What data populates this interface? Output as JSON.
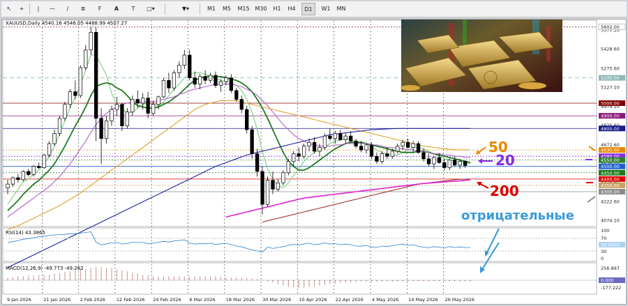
{
  "toolbar": {
    "timeframes": [
      "M1",
      "M5",
      "M15",
      "M30",
      "H1",
      "H4",
      "D1",
      "W1",
      "MN"
    ],
    "icons": [
      "cursor-icon",
      "crosshair-icon",
      "vertical-line-icon",
      "horizontal-line-icon",
      "trendline-icon",
      "channel-icon",
      "fibonacci-icon",
      "text-icon",
      "label-icon",
      "shapes-icon"
    ]
  },
  "chart": {
    "symbol_line": "XAUUSD,Daily  4540.16 4546.05 4488.99 4507.27",
    "rsi_label": "RSI(14) 43.3865",
    "macd_label": "MACD(12,26,9) -49.773 -49.262",
    "bg_color": "#ffffff",
    "bull_color": "#ffffff",
    "bear_color": "#000000"
  },
  "price_axis": {
    "ticks": [
      "5577.10",
      "5428.60",
      "5275.60",
      "5127.10",
      "4974.10",
      "4825.60",
      "4672.60",
      "4524.10",
      "4375.60",
      "4222.60",
      "4074.10"
    ],
    "labels": [
      {
        "text": "5602.00",
        "bg": "#ffffff",
        "fg": "#222222",
        "border": "#888888",
        "price": 5602
      },
      {
        "text": "5200.00",
        "bg": "#8fb8b8",
        "fg": "#ffffff",
        "price": 5200
      },
      {
        "text": "5000.00",
        "bg": "#800000",
        "fg": "#ffffff",
        "price": 5000
      },
      {
        "text": "4900.00",
        "bg": "#8a1a7a",
        "fg": "#ffffff",
        "price": 4900
      },
      {
        "text": "4800.00",
        "bg": "#1a1a8a",
        "fg": "#ffffff",
        "price": 4800
      },
      {
        "text": "4630.00",
        "bg": "#e88a00",
        "fg": "#ffffff",
        "price": 4630
      },
      {
        "text": "4580.00",
        "bg": "#8a2be2",
        "fg": "#ffffff",
        "price": 4580
      },
      {
        "text": "4550.00",
        "bg": "#2e7d32",
        "fg": "#ffffff",
        "price": 4550
      },
      {
        "text": "4500.00",
        "bg": "#1e60d0",
        "fg": "#ffffff",
        "price": 4500
      },
      {
        "text": "4450.00",
        "bg": "#1a7a1a",
        "fg": "#ffffff",
        "price": 4450
      },
      {
        "text": "4400.00",
        "bg": "#e00000",
        "fg": "#ffffff",
        "price": 4400
      },
      {
        "text": "4350.00",
        "bg": "#c8a060",
        "fg": "#ffffff",
        "price": 4350
      },
      {
        "text": "4300.00",
        "bg": "#8a8a8a",
        "fg": "#ffffff",
        "price": 4300
      }
    ]
  },
  "rsi_axis": {
    "ticks": [
      "100",
      "70",
      "30",
      "0"
    ],
    "current": "50.0000"
  },
  "macd_axis": {
    "ticks": [
      "256.897",
      "0.000",
      "-177.222"
    ]
  },
  "time_axis": [
    "9 Jan 2026",
    "21 Jan 2026",
    "2 Feb 2026",
    "12 Feb 2026",
    "24 Feb 2026",
    "6 Mar 2026",
    "18 Mar 2026",
    "30 Mar 2026",
    "10 Apr 2026",
    "22 Apr 2026",
    "4 May 2026",
    "14 May 2026",
    "26 May 2026"
  ],
  "annotations": {
    "ma50": {
      "text": "50",
      "color": "#e88a00"
    },
    "ma20": {
      "text": "20",
      "color": "#8a2be2"
    },
    "ma200": {
      "text": "200",
      "color": "#e00000"
    },
    "negative": {
      "text": "отрицательные",
      "color": "#3a9ad9"
    }
  },
  "candles": [
    [
      4330,
      4395,
      4280,
      4360
    ],
    [
      4360,
      4420,
      4340,
      4410
    ],
    [
      4410,
      4440,
      4370,
      4395
    ],
    [
      4395,
      4470,
      4380,
      4460
    ],
    [
      4460,
      4480,
      4420,
      4435
    ],
    [
      4435,
      4510,
      4420,
      4500
    ],
    [
      4500,
      4530,
      4480,
      4490
    ],
    [
      4490,
      4600,
      4480,
      4590
    ],
    [
      4590,
      4700,
      4570,
      4680
    ],
    [
      4680,
      4790,
      4660,
      4760
    ],
    [
      4760,
      4900,
      4740,
      4880
    ],
    [
      4880,
      5010,
      4860,
      4990
    ],
    [
      4990,
      5110,
      4960,
      5090
    ],
    [
      5090,
      5180,
      5030,
      5060
    ],
    [
      5060,
      5300,
      5040,
      5280
    ],
    [
      5280,
      5460,
      5260,
      5420
    ],
    [
      5420,
      5602,
      5380,
      5560
    ],
    [
      5560,
      5600,
      4700,
      4880
    ],
    [
      4880,
      4960,
      4520,
      4720
    ],
    [
      4720,
      4900,
      4680,
      4860
    ],
    [
      4860,
      4980,
      4820,
      4950
    ],
    [
      4950,
      5050,
      4900,
      4990
    ],
    [
      4990,
      5000,
      4780,
      4820
    ],
    [
      4820,
      4960,
      4800,
      4930
    ],
    [
      4930,
      5060,
      4900,
      5030
    ],
    [
      5030,
      5100,
      4960,
      5000
    ],
    [
      5000,
      5080,
      4950,
      5040
    ],
    [
      5040,
      5090,
      4880,
      4920
    ],
    [
      4920,
      5020,
      4900,
      4990
    ],
    [
      4990,
      5060,
      4950,
      5050
    ],
    [
      5050,
      5200,
      5040,
      5180
    ],
    [
      5180,
      5240,
      5080,
      5120
    ],
    [
      5120,
      5260,
      5100,
      5240
    ],
    [
      5240,
      5330,
      5200,
      5300
    ],
    [
      5300,
      5420,
      5270,
      5380
    ],
    [
      5380,
      5420,
      5180,
      5200
    ],
    [
      5200,
      5250,
      5120,
      5150
    ],
    [
      5150,
      5230,
      5110,
      5210
    ],
    [
      5210,
      5260,
      5150,
      5180
    ],
    [
      5180,
      5240,
      5160,
      5220
    ],
    [
      5220,
      5250,
      5120,
      5140
    ],
    [
      5140,
      5190,
      5090,
      5170
    ],
    [
      5170,
      5220,
      5140,
      5200
    ],
    [
      5200,
      5230,
      5080,
      5100
    ],
    [
      5100,
      5120,
      5010,
      5030
    ],
    [
      5030,
      5060,
      4920,
      4950
    ],
    [
      4950,
      4980,
      4760,
      4790
    ],
    [
      4790,
      4820,
      4560,
      4600
    ],
    [
      4600,
      4640,
      4420,
      4460
    ],
    [
      4460,
      4500,
      4120,
      4200
    ],
    [
      4200,
      4420,
      4180,
      4390
    ],
    [
      4390,
      4460,
      4280,
      4320
    ],
    [
      4320,
      4400,
      4300,
      4370
    ],
    [
      4370,
      4470,
      4350,
      4450
    ],
    [
      4450,
      4560,
      4430,
      4540
    ],
    [
      4540,
      4620,
      4500,
      4600
    ],
    [
      4600,
      4650,
      4540,
      4580
    ],
    [
      4580,
      4680,
      4560,
      4660
    ],
    [
      4660,
      4720,
      4620,
      4690
    ],
    [
      4690,
      4730,
      4600,
      4620
    ],
    [
      4620,
      4680,
      4580,
      4650
    ],
    [
      4650,
      4760,
      4630,
      4740
    ],
    [
      4740,
      4800,
      4700,
      4720
    ],
    [
      4720,
      4780,
      4680,
      4760
    ],
    [
      4760,
      4790,
      4700,
      4710
    ],
    [
      4710,
      4760,
      4680,
      4740
    ],
    [
      4740,
      4780,
      4690,
      4700
    ],
    [
      4700,
      4720,
      4640,
      4660
    ],
    [
      4660,
      4700,
      4610,
      4630
    ],
    [
      4630,
      4680,
      4600,
      4670
    ],
    [
      4670,
      4690,
      4560,
      4580
    ],
    [
      4580,
      4610,
      4520,
      4540
    ],
    [
      4540,
      4620,
      4520,
      4600
    ],
    [
      4600,
      4650,
      4560,
      4580
    ],
    [
      4580,
      4640,
      4560,
      4620
    ],
    [
      4620,
      4680,
      4600,
      4660
    ],
    [
      4660,
      4710,
      4630,
      4690
    ],
    [
      4690,
      4720,
      4640,
      4650
    ],
    [
      4650,
      4700,
      4610,
      4680
    ],
    [
      4680,
      4700,
      4600,
      4610
    ],
    [
      4610,
      4640,
      4540,
      4560
    ],
    [
      4560,
      4600,
      4500,
      4520
    ],
    [
      4520,
      4580,
      4480,
      4570
    ],
    [
      4570,
      4600,
      4520,
      4530
    ],
    [
      4530,
      4560,
      4470,
      4490
    ],
    [
      4490,
      4560,
      4470,
      4550
    ],
    [
      4550,
      4580,
      4500,
      4510
    ],
    [
      4510,
      4560,
      4480,
      4540
    ],
    [
      4540,
      4546,
      4489,
      4507
    ]
  ],
  "ma_lines": [
    {
      "name": "ma5",
      "color": "#7ccf7c",
      "values": [
        4200,
        4260,
        4320,
        4380,
        4400,
        4440,
        4470,
        4520,
        4580,
        4660,
        4760,
        4860,
        4960,
        5050,
        5140,
        5260,
        5380,
        5380,
        5300,
        5220,
        5080,
        4980,
        4960,
        4920,
        4930,
        4960,
        4990,
        5000,
        4990,
        4980,
        5010,
        5060,
        5110,
        5150,
        5200,
        5230,
        5240,
        5240,
        5230,
        5210,
        5190,
        5180,
        5170,
        5160,
        5140,
        5100,
        5030,
        4930,
        4790,
        4620,
        4480,
        4400,
        4350,
        4330,
        4370,
        4430,
        4480,
        4540,
        4580,
        4610,
        4630,
        4650,
        4680,
        4700,
        4710,
        4720,
        4710,
        4700,
        4690,
        4680,
        4660,
        4630,
        4610,
        4600,
        4590,
        4590,
        4610,
        4630,
        4650,
        4650,
        4640,
        4620,
        4600,
        4580,
        4560,
        4550,
        4540,
        4530,
        4530,
        4520
      ]
    },
    {
      "name": "ma10",
      "color": "#1e7a1e",
      "values": [
        4150,
        4190,
        4230,
        4280,
        4320,
        4360,
        4390,
        4430,
        4470,
        4520,
        4590,
        4660,
        4740,
        4820,
        4890,
        4970,
        5060,
        5130,
        5150,
        5160,
        5150,
        5120,
        5100,
        5060,
        5010,
        4980,
        4970,
        4960,
        4960,
        4970,
        4990,
        5010,
        5040,
        5070,
        5110,
        5150,
        5180,
        5200,
        5210,
        5210,
        5210,
        5210,
        5200,
        5190,
        5180,
        5160,
        5130,
        5090,
        5030,
        4960,
        4880,
        4790,
        4700,
        4610,
        4540,
        4500,
        4470,
        4470,
        4490,
        4520,
        4550,
        4580,
        4610,
        4640,
        4660,
        4680,
        4690,
        4690,
        4690,
        4680,
        4670,
        4660,
        4650,
        4640,
        4630,
        4620,
        4610,
        4610,
        4610,
        4620,
        4620,
        4610,
        4600,
        4590,
        4580,
        4570,
        4560,
        4550,
        4540,
        4530
      ]
    },
    {
      "name": "ma20",
      "color": "#b060d0",
      "values": [
        4100,
        4130,
        4160,
        4190,
        4220,
        4250,
        4280,
        4310,
        4340,
        4380,
        4420,
        4470,
        4520,
        4580,
        4640,
        4700,
        4770,
        4830,
        4880,
        4920,
        4950,
        4970,
        4990,
        5000,
        5010,
        5010,
        5010,
        5010,
        5010,
        5020,
        5030,
        5040,
        5050,
        5070,
        5080,
        5100,
        5110,
        5120,
        5130,
        5140,
        5150,
        5150,
        5150,
        5150,
        5140,
        5130,
        5110,
        5090,
        5060,
        5020,
        4980,
        4930,
        4880,
        4830,
        4790,
        4750,
        4720,
        4700,
        4680,
        4670,
        4660,
        4660,
        4660,
        4670,
        4670,
        4680,
        4680,
        4680,
        4680,
        4680,
        4670,
        4670,
        4660,
        4650,
        4650,
        4640,
        4640,
        4630,
        4630,
        4620,
        4620,
        4610,
        4600,
        4600,
        4590,
        4590,
        4580,
        4580,
        4570,
        4570
      ]
    },
    {
      "name": "ma50",
      "color": "#e0a030",
      "values": [
        4000,
        4015,
        4030,
        4050,
        4070,
        4090,
        4110,
        4130,
        4150,
        4170,
        4190,
        4215,
        4240,
        4265,
        4290,
        4320,
        4350,
        4380,
        4410,
        4440,
        4470,
        4500,
        4530,
        4560,
        4590,
        4620,
        4650,
        4680,
        4710,
        4740,
        4770,
        4800,
        4830,
        4860,
        4890,
        4920,
        4950,
        4970,
        4990,
        5000,
        5010,
        5020,
        5020,
        5020,
        5020,
        5010,
        5000,
        4990,
        4980,
        4970,
        4960,
        4950,
        4940,
        4930,
        4920,
        4910,
        4900,
        4890,
        4880,
        4870,
        4860,
        4850,
        4840,
        4830,
        4820,
        4810,
        4800,
        4790,
        4780,
        4770,
        4760,
        4750,
        4740,
        4730,
        4720,
        4710,
        4700,
        4690,
        4680,
        4670,
        4660,
        4655,
        4650,
        4645,
        4640,
        4635,
        4632,
        4630,
        4630,
        4630
      ]
    },
    {
      "name": "ma100",
      "color": "#2020a0",
      "values": [
        3700,
        3720,
        3740,
        3760,
        3780,
        3800,
        3820,
        3840,
        3860,
        3880,
        3900,
        3920,
        3940,
        3960,
        3980,
        4000,
        4020,
        4040,
        4060,
        4080,
        4100,
        4120,
        4140,
        4160,
        4180,
        4200,
        4220,
        4240,
        4260,
        4280,
        4300,
        4320,
        4340,
        4360,
        4380,
        4400,
        4420,
        4440,
        4460,
        4480,
        4500,
        4515,
        4530,
        4545,
        4560,
        4575,
        4590,
        4600,
        4610,
        4620,
        4630,
        4640,
        4650,
        4660,
        4670,
        4680,
        4690,
        4700,
        4710,
        4720,
        4730,
        4740,
        4750,
        4755,
        4760,
        4765,
        4770,
        4775,
        4780,
        4785,
        4790,
        4792,
        4794,
        4796,
        4798,
        4799,
        4800,
        4800,
        4800,
        4800,
        4800,
        4800,
        4800,
        4800,
        4800,
        4800,
        4800,
        4800,
        4800,
        4800
      ]
    },
    {
      "name": "ma200",
      "color": "#a03030",
      "values": [
        null,
        null,
        null,
        null,
        null,
        null,
        null,
        null,
        null,
        null,
        null,
        null,
        null,
        null,
        null,
        null,
        null,
        null,
        null,
        null,
        null,
        null,
        null,
        null,
        null,
        null,
        null,
        null,
        null,
        null,
        null,
        null,
        null,
        null,
        null,
        null,
        null,
        null,
        null,
        null,
        null,
        null,
        null,
        null,
        null,
        null,
        null,
        null,
        null,
        4060,
        4070,
        4080,
        4090,
        4100,
        4110,
        4120,
        4130,
        4140,
        4150,
        4160,
        4170,
        4180,
        4190,
        4200,
        4210,
        4220,
        4230,
        4240,
        4250,
        4260,
        4270,
        4280,
        4290,
        4300,
        4310,
        4320,
        4330,
        4340,
        4350,
        4360,
        4365,
        4370,
        4375,
        4380,
        4385,
        4390,
        4395,
        4398,
        4400,
        4400
      ]
    },
    {
      "name": "ma_magenta",
      "color": "#e020d0",
      "values": [
        null,
        null,
        null,
        null,
        null,
        null,
        null,
        null,
        null,
        null,
        null,
        null,
        null,
        null,
        null,
        null,
        null,
        null,
        null,
        null,
        null,
        null,
        null,
        null,
        null,
        null,
        null,
        null,
        null,
        null,
        null,
        null,
        null,
        null,
        null,
        null,
        null,
        null,
        null,
        null,
        null,
        null,
        4100,
        4110,
        4120,
        4130,
        4140,
        4150,
        4160,
        4170,
        4180,
        4190,
        4200,
        4210,
        4220,
        4230,
        4240,
        4250,
        4255,
        4260,
        4265,
        4270,
        4275,
        4280,
        4285,
        4290,
        4295,
        4300,
        4305,
        4310,
        4315,
        4320,
        4325,
        4330,
        4335,
        4340,
        4345,
        4350,
        4355,
        4360,
        4365,
        4368,
        4371,
        4374,
        4377,
        4380,
        4383,
        4386,
        4390,
        4395
      ]
    }
  ],
  "rsi_values": [
    60,
    62,
    66,
    70,
    72,
    75,
    78,
    80,
    82,
    84,
    85,
    86,
    88,
    88,
    90,
    92,
    94,
    60,
    52,
    55,
    58,
    60,
    54,
    56,
    60,
    59,
    60,
    55,
    57,
    60,
    63,
    61,
    64,
    66,
    68,
    57,
    54,
    56,
    55,
    57,
    53,
    55,
    57,
    52,
    48,
    45,
    40,
    35,
    32,
    28,
    44,
    40,
    43,
    46,
    50,
    53,
    51,
    55,
    57,
    52,
    54,
    58,
    54,
    56,
    52,
    54,
    52,
    48,
    47,
    50,
    45,
    43,
    48,
    46,
    49,
    52,
    54,
    50,
    52,
    47,
    44,
    42,
    46,
    44,
    41,
    46,
    43,
    45,
    43,
    43
  ]
}
